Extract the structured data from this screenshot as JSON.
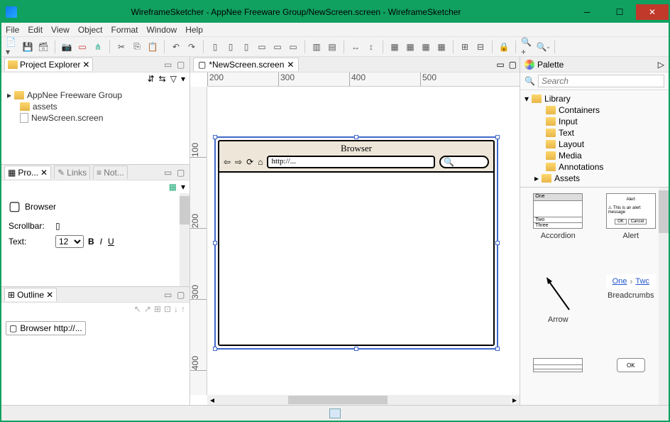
{
  "window": {
    "title": "WireframeSketcher - AppNee Freeware Group/NewScreen.screen - WireframeSketcher"
  },
  "menu": {
    "file": "File",
    "edit": "Edit",
    "view": "View",
    "object": "Object",
    "format": "Format",
    "window": "Window",
    "help": "Help"
  },
  "explorer": {
    "tab": "Project Explorer",
    "project": "AppNee Freeware Group",
    "folder_assets": "assets",
    "file_screen": "NewScreen.screen"
  },
  "props": {
    "tab_properties": "Pro...",
    "tab_links": "Links",
    "tab_notes": "Not...",
    "heading": "Browser",
    "label_scrollbar": "Scrollbar:",
    "label_text": "Text:",
    "font_size": "12"
  },
  "outline": {
    "tab": "Outline",
    "item": "Browser http://..."
  },
  "editor": {
    "tab": "*NewScreen.screen",
    "ruler_h": [
      "200",
      "300",
      "400",
      "500"
    ],
    "ruler_v": [
      "100",
      "200",
      "300",
      "400"
    ],
    "browser_title": "Browser",
    "browser_url": "http://..."
  },
  "palette": {
    "title": "Palette",
    "search_placeholder": "Search",
    "library": "Library",
    "categories": {
      "containers": "Containers",
      "input": "Input",
      "text": "Text",
      "layout": "Layout",
      "media": "Media",
      "annotations": "Annotations"
    },
    "assets": "Assets",
    "widgets": {
      "accordion": "Accordion",
      "alert": "Alert",
      "arrow": "Arrow",
      "breadcrumbs": "Breadcrumbs",
      "bc_one": "One",
      "bc_two": "Twc"
    }
  }
}
